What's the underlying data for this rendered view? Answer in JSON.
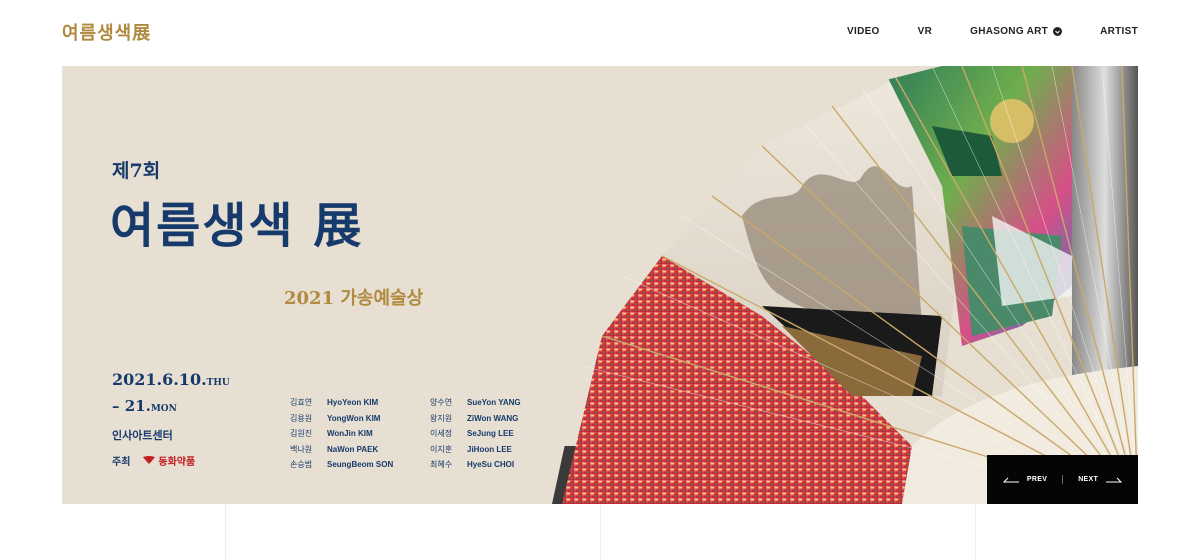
{
  "header": {
    "logo": "여름생색展",
    "nav": [
      {
        "label": "VIDEO"
      },
      {
        "label": "VR"
      },
      {
        "label": "GHASONG ART"
      },
      {
        "label": "ARTIST"
      }
    ]
  },
  "banner": {
    "ordinal": "제7회",
    "title": "여름생색 展",
    "subtitle": "2021 가송예술상",
    "date_start": "2021.6.10.",
    "date_start_day": "THU",
    "date_end": "– 21.",
    "date_end_day": "MON",
    "venue": "인사아트센터",
    "host_label": "주최",
    "host_name": "동화약품",
    "artists_left": [
      {
        "kr": "김효연",
        "en": "HyoYeon KIM"
      },
      {
        "kr": "김용원",
        "en": "YongWon KIM"
      },
      {
        "kr": "김원진",
        "en": "WonJin KIM"
      },
      {
        "kr": "백나원",
        "en": "NaWon PAEK"
      },
      {
        "kr": "손승범",
        "en": "SeungBeom SON"
      }
    ],
    "artists_right": [
      {
        "kr": "양수연",
        "en": "SueYon YANG"
      },
      {
        "kr": "왕지원",
        "en": "ZiWon WANG"
      },
      {
        "kr": "이세정",
        "en": "SeJung LEE"
      },
      {
        "kr": "이지훈",
        "en": "JiHoon LEE"
      },
      {
        "kr": "최혜수",
        "en": "HyeSu CHOI"
      }
    ]
  },
  "controls": {
    "prev": "PREV",
    "next": "NEXT"
  },
  "colors": {
    "navy": "#163a6b",
    "gold": "#b08a3e",
    "banner_bg": "#e7dfd2",
    "control_bg": "#050505"
  }
}
